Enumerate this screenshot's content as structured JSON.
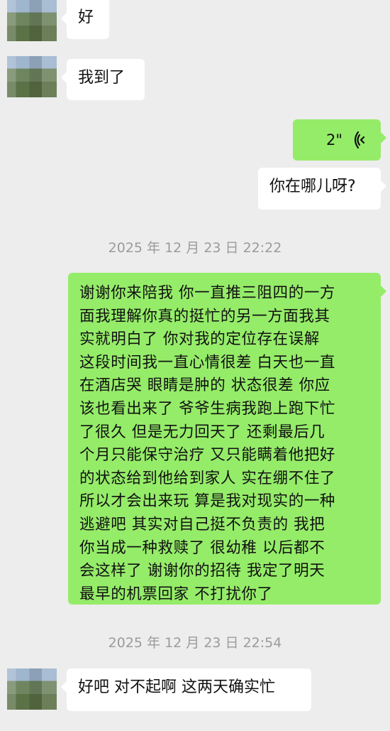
{
  "messages": {
    "m1": "好",
    "m2": "我到了",
    "voice_duration": "2\"",
    "m3": "你在哪儿呀?",
    "ts1": "2025 年 12 月 23 日  22:22",
    "long_lines": [
      "谢谢你来陪我 你一直推三阻四的一方",
      "面我理解你真的挺忙的另一方面我其",
      "实就明白了 你对我的定位存在误解",
      "这段时间我一直心情很差 白天也一直",
      "在酒店哭 眼睛是肿的 状态很差 你应",
      "该也看出来了 爷爷生病我跑上跑下忙",
      "了很久 但是无力回天了 还剩最后几",
      "个月只能保守治疗 又只能瞒着他把好",
      "的状态给到他给到家人 实在绷不住了",
      "所以才会出来玩 算是我对现实的一种",
      "逃避吧 其实对自己挺不负责的 我把",
      "你当成一种救赎了 很幼稚 以后都不",
      "会这样了 谢谢你的招待 我定了明天",
      "最早的机票回家 不打扰你了"
    ],
    "ts2": "2025 年 12 月 23 日  22:54",
    "m4": "好吧 对不起啊 这两天确实忙"
  },
  "icons": {
    "avatar": "avatar-blurred",
    "voice": "voice-wave-icon"
  },
  "colors": {
    "background": "#ededed",
    "sent_bubble": "#95ec69",
    "received_bubble": "#ffffff",
    "timestamp": "#9b9b9b"
  }
}
